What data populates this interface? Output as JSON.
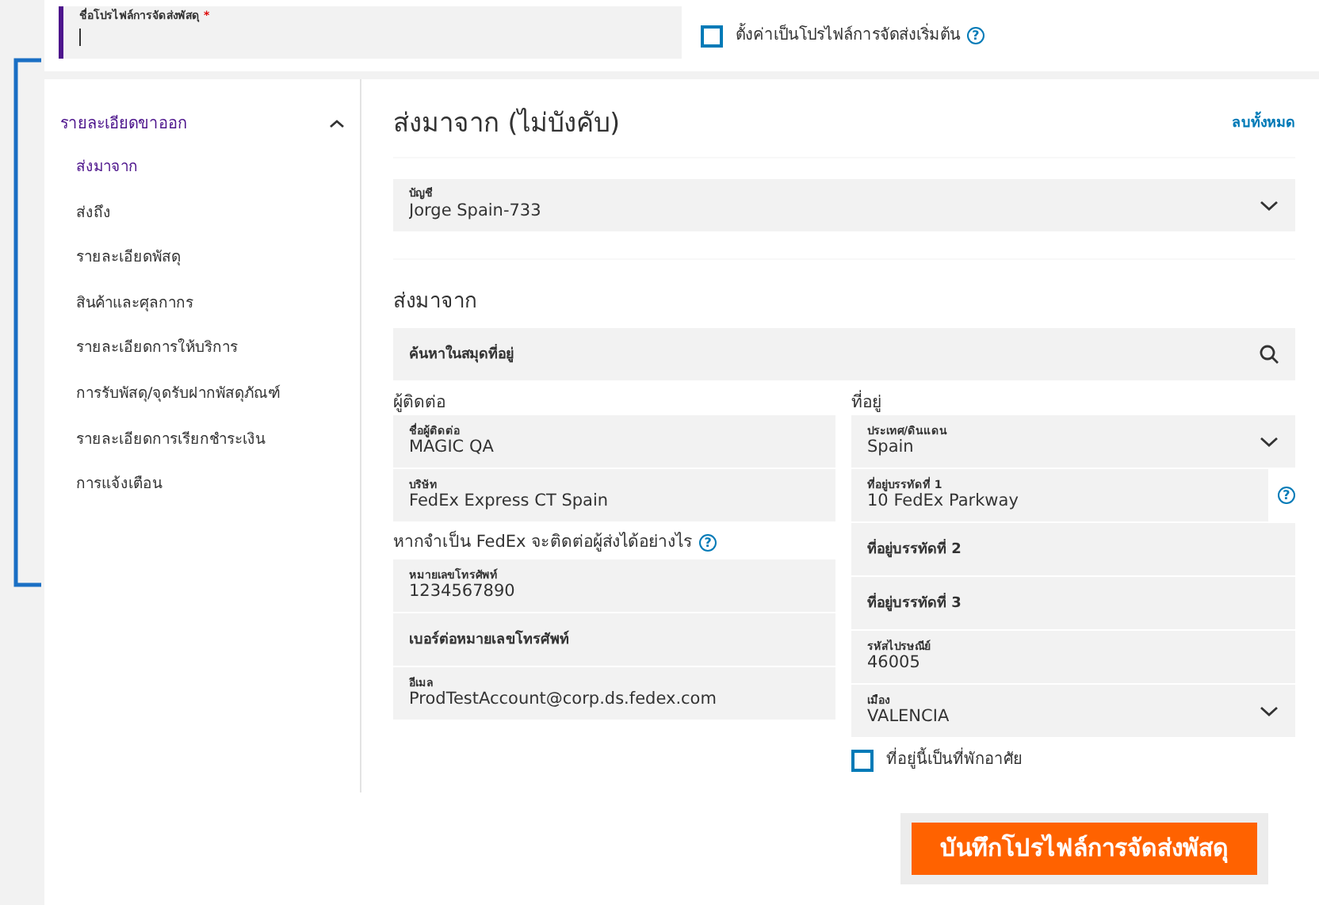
{
  "profile_name": {
    "label": "ชื่อโปรไฟล์การจัดส่งพัสดุ",
    "required_mark": "*"
  },
  "default_checkbox": {
    "label": "ตั้งค่าเป็นโปรไฟล์การจัดส่งเริ่มต้น",
    "checked": false,
    "help": "?"
  },
  "sidebar": {
    "title": "รายละเอียดขาออก",
    "expanded": true,
    "items": [
      {
        "label": "ส่งมาจาก",
        "selected": true
      },
      {
        "label": "ส่งถึง",
        "selected": false
      },
      {
        "label": "รายละเอียดพัสดุ",
        "selected": false
      },
      {
        "label": "สินค้าและศุลกากร",
        "selected": false
      },
      {
        "label": "รายละเอียดการให้บริการ",
        "selected": false
      },
      {
        "label": "การรับพัสดุ/จุดรับฝากพัสดุภัณฑ์",
        "selected": false
      },
      {
        "label": "รายละเอียดการเรียกชำระเงิน",
        "selected": false
      },
      {
        "label": "การแจ้งเตือน",
        "selected": false
      }
    ]
  },
  "section": {
    "title": "ส่งมาจาก (ไม่บังคับ)",
    "clear_link": "ลบทั้งหมด"
  },
  "account": {
    "kind": "select",
    "label": "บัญชี",
    "value": "Jorge Spain-733"
  },
  "from_heading": "ส่งมาจาก",
  "address_search": {
    "placeholder": "ค้นหาในสมุดที่อยู่"
  },
  "contact": {
    "heading": "ผู้ติดต่อ",
    "fields": [
      {
        "kind": "text",
        "label": "ชื่อผู้ติดต่อ",
        "value": "MAGIC QA"
      },
      {
        "kind": "text",
        "label": "บริษัท",
        "value": "FedEx Express CT Spain"
      }
    ]
  },
  "fedex_contact": {
    "heading": "หากจำเป็น FedEx จะติดต่อผู้ส่งได้อย่างไร",
    "help": "?",
    "fields": [
      {
        "kind": "text",
        "label": "หมายเลขโทรศัพท์",
        "value": "1234567890"
      },
      {
        "kind": "text",
        "placeholder": "เบอร์ต่อหมายเลขโทรศัพท์"
      },
      {
        "kind": "text",
        "label": "อีเมล",
        "value": "ProdTestAccount@corp.ds.fedex.com"
      }
    ]
  },
  "address": {
    "heading": "ที่อยู่",
    "fields": [
      {
        "kind": "select",
        "label": "ประเทศ/ดินแดน",
        "value": "Spain"
      },
      {
        "kind": "text",
        "label": "ที่อยู่บรรทัดที่ 1",
        "value": "10 FedEx Parkway",
        "help": "?"
      },
      {
        "kind": "text",
        "placeholder": "ที่อยู่บรรทัดที่ 2"
      },
      {
        "kind": "text",
        "placeholder": "ที่อยู่บรรทัดที่ 3"
      },
      {
        "kind": "text",
        "label": "รหัสไปรษณีย์",
        "value": "46005"
      },
      {
        "kind": "select",
        "label": "เมือง",
        "value": "VALENCIA"
      }
    ],
    "residential": {
      "label": "ที่อยู่นี้เป็นที่พักอาศัย",
      "checked": false
    }
  },
  "save_button": "บันทึกโปรไฟล์การจัดส่งพัสดุ"
}
